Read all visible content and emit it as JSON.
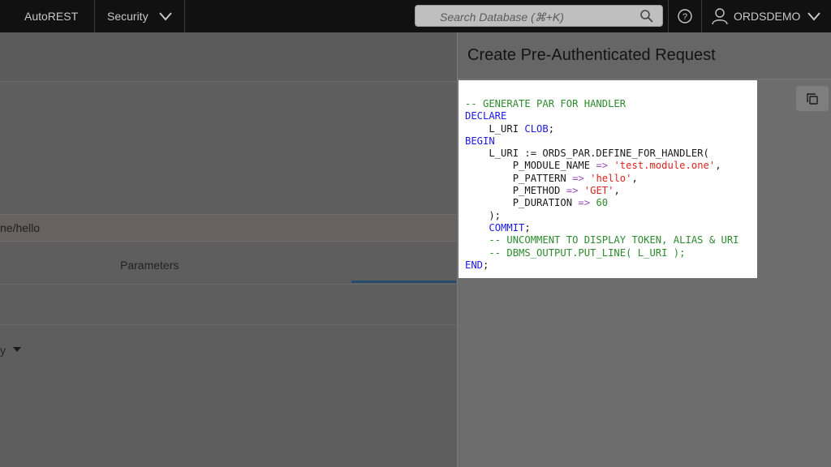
{
  "topbar": {
    "autorest_label": "AutoREST",
    "security_label": "Security",
    "search_placeholder": "Search Database (⌘+K)",
    "username": "ORDSDEMO"
  },
  "background": {
    "url_fragment": "ne/hello",
    "tab_parameters": "Parameters",
    "select_fragment": "y"
  },
  "drawer": {
    "title": "Create Pre-Authenticated Request",
    "code": {
      "line1": "-- GENERATE PAR FOR HANDLER",
      "line2": "DECLARE",
      "line3_a": "    L_URI ",
      "line3_b": "CLOB",
      "line3_c": ";",
      "line4": "BEGIN",
      "line5": "    L_URI := ORDS_PAR.DEFINE_FOR_HANDLER(",
      "line6_a": "        P_MODULE_NAME ",
      "line6_op": "=>",
      "line6_b": " ",
      "line6_str": "'test.module.one'",
      "line6_c": ",",
      "line7_a": "        P_PATTERN ",
      "line7_op": "=>",
      "line7_b": " ",
      "line7_str": "'hello'",
      "line7_c": ",",
      "line8_a": "        P_METHOD ",
      "line8_op": "=>",
      "line8_b": " ",
      "line8_str": "'GET'",
      "line8_c": ",",
      "line9_a": "        P_DURATION ",
      "line9_op": "=>",
      "line9_b": " ",
      "line9_num": "60",
      "line10": "    );",
      "line11_a": "    ",
      "line11_kw": "COMMIT",
      "line11_c": ";",
      "line12": "    -- UNCOMMENT TO DISPLAY TOKEN, ALIAS & URI",
      "line13": "    -- DBMS_OUTPUT.PUT_LINE( L_URI );",
      "line14_kw": "END",
      "line14_c": ";"
    }
  },
  "icons": {
    "search": "search-icon",
    "help": "help-icon",
    "user": "user-icon",
    "chevron": "chevron-down-icon",
    "copy": "copy-icon"
  }
}
